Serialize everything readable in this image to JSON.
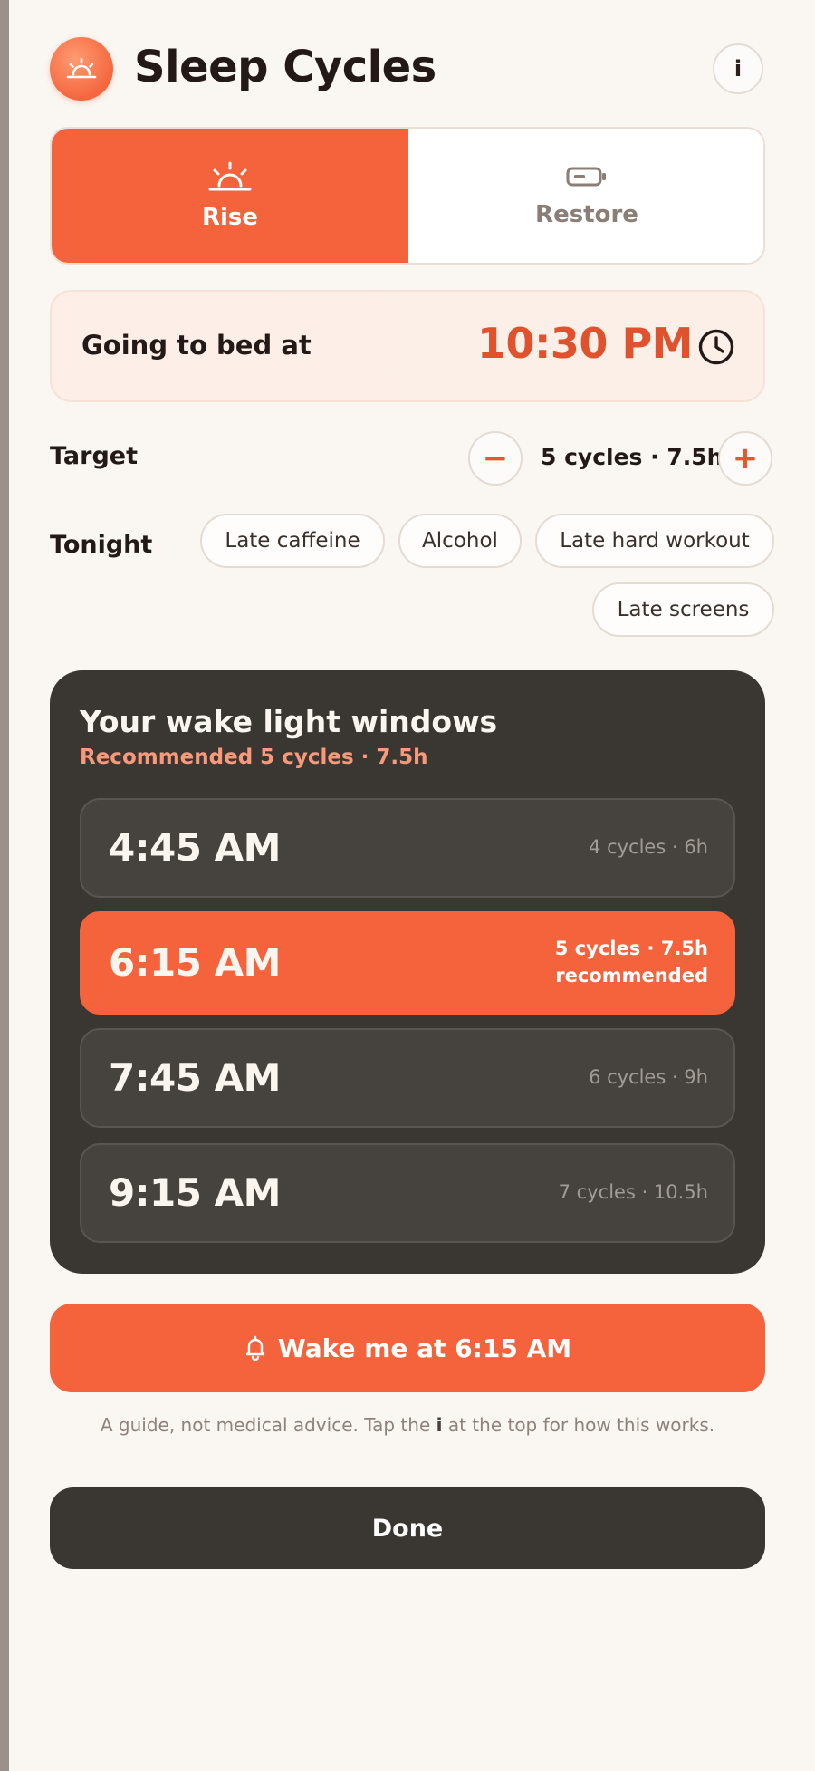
{
  "header": {
    "title": "Sleep Cycles",
    "info_label": "i",
    "logo_icon": "sunrise-icon"
  },
  "mode": {
    "rise_label": "Rise",
    "restore_label": "Restore",
    "selected": "Rise",
    "rise_icon": "sunrise-icon",
    "restore_icon": "battery-icon"
  },
  "bedtime": {
    "label": "Going to bed at",
    "time": "10:30 PM",
    "icon": "clock-icon"
  },
  "target": {
    "label": "Target",
    "value": "5 cycles · 7.5h",
    "decrement": "−",
    "increment": "+"
  },
  "tonight": {
    "label": "Tonight",
    "chips": [
      "Late caffeine",
      "Alcohol",
      "Late hard workout",
      "Late screens"
    ]
  },
  "windows": {
    "title": "Your wake light windows",
    "subtitle": "Recommended 5 cycles · 7.5h",
    "rows": [
      {
        "time": "4:45 AM",
        "meta": "4 cycles · 6h",
        "tag": ""
      },
      {
        "time": "6:15 AM",
        "meta": "5 cycles · 7.5h",
        "tag": "recommended"
      },
      {
        "time": "7:45 AM",
        "meta": "6 cycles · 9h",
        "tag": ""
      },
      {
        "time": "9:15 AM",
        "meta": "7 cycles · 10.5h",
        "tag": ""
      }
    ]
  },
  "wake_button": {
    "label": "Wake me at 6:15 AM",
    "icon": "bell-icon"
  },
  "disclaimer": {
    "before": "A guide, not medical advice. Tap the ",
    "bold": "i",
    "after": " at the top for how this works."
  },
  "done_button": {
    "label": "Done"
  },
  "colors": {
    "accent": "#f4633c",
    "accent_text": "#e0512e",
    "dark": "#3a3632",
    "background": "#faf6f2"
  }
}
